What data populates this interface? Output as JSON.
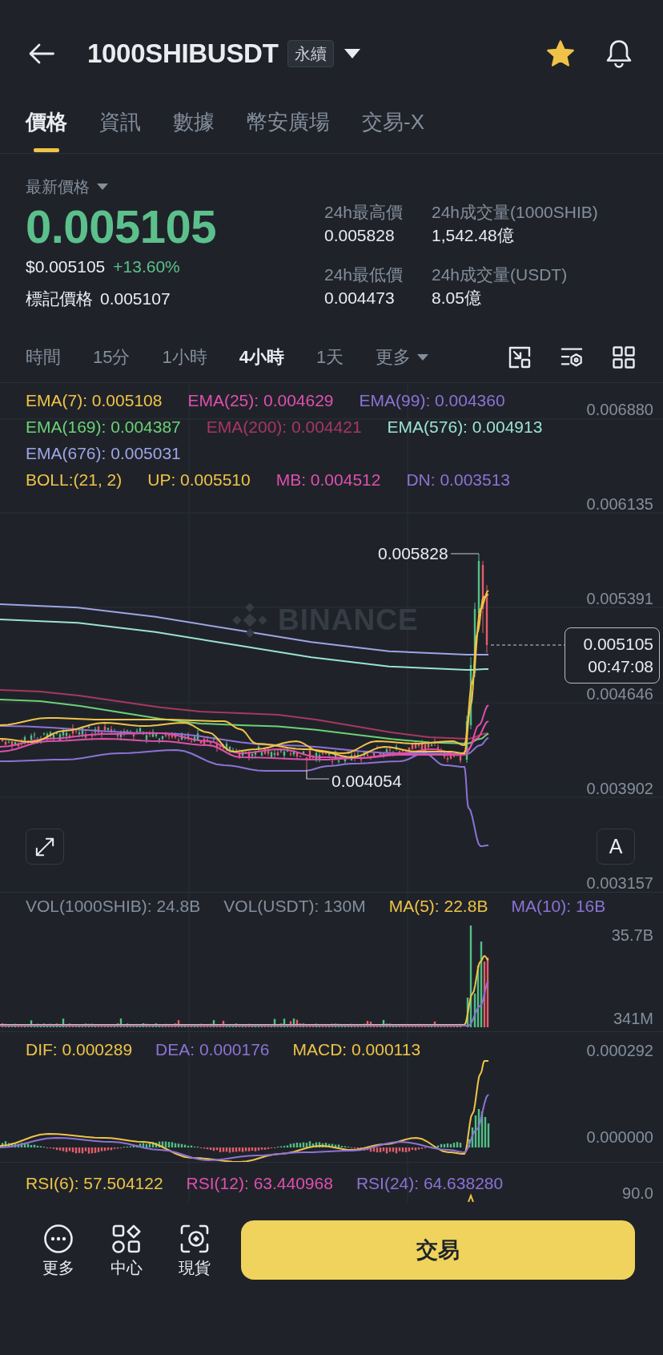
{
  "header": {
    "symbol": "1000SHIBUSDT",
    "contract_badge": "永續",
    "favorited": true
  },
  "tabs": [
    {
      "label": "價格",
      "selected": true
    },
    {
      "label": "資訊",
      "selected": false
    },
    {
      "label": "數據",
      "selected": false
    },
    {
      "label": "幣安廣場",
      "selected": false
    },
    {
      "label": "交易-X",
      "selected": false
    }
  ],
  "price": {
    "label": "最新價格",
    "last": "0.005105",
    "usd": "$0.005105",
    "change": "+13.60%",
    "mark_label": "標記價格",
    "mark_value": "0.005107"
  },
  "stats": [
    {
      "label": "24h最高價",
      "value": "0.005828"
    },
    {
      "label": "24h成交量(1000SHIB)",
      "value": "1,542.48億"
    },
    {
      "label": "24h最低價",
      "value": "0.004473"
    },
    {
      "label": "24h成交量(USDT)",
      "value": "8.05億"
    }
  ],
  "intervals": {
    "label": "時間",
    "options": [
      {
        "label": "15分",
        "selected": false
      },
      {
        "label": "1小時",
        "selected": false
      },
      {
        "label": "4小時",
        "selected": true
      },
      {
        "label": "1天",
        "selected": false
      }
    ],
    "more": "更多"
  },
  "main_chart": {
    "legend_rows": [
      [
        {
          "text": "EMA(7): 0.005108",
          "color": "#f0c348"
        },
        {
          "text": "EMA(25): 0.004629",
          "color": "#e04fae"
        },
        {
          "text": "EMA(99): 0.004360",
          "color": "#8d72d6"
        }
      ],
      [
        {
          "text": "EMA(169): 0.004387",
          "color": "#6bd276"
        },
        {
          "text": "EMA(200): 0.004421",
          "color": "#a8375f"
        },
        {
          "text": "EMA(576): 0.004913",
          "color": "#9be3d0"
        }
      ],
      [
        {
          "text": "EMA(676): 0.005031",
          "color": "#9fa4e6"
        }
      ],
      [
        {
          "text": "BOLL:(21, 2)",
          "color": "#f0c348"
        },
        {
          "text": "UP: 0.005510",
          "color": "#f0c348"
        },
        {
          "text": "MB: 0.004512",
          "color": "#e04fae"
        },
        {
          "text": "DN: 0.003513",
          "color": "#8d72d6"
        }
      ]
    ],
    "price_axis": [
      "0.006880",
      "0.006135",
      "0.005391",
      "0.004646",
      "0.003902",
      "0.003157"
    ],
    "high_label": "0.005828",
    "low_label": "0.004054",
    "last_price": "0.005105",
    "countdown": "00:47:08",
    "watermark": "BINANCE",
    "scale_button": "A"
  },
  "volume_panel": {
    "legend": [
      {
        "text": "VOL(1000SHIB): 24.8B",
        "color": "#848e9c"
      },
      {
        "text": "VOL(USDT): 130M",
        "color": "#848e9c"
      },
      {
        "text": "MA(5): 22.8B",
        "color": "#f0c348"
      },
      {
        "text": "MA(10): 16B",
        "color": "#8d72d6"
      }
    ],
    "axis": [
      "35.7B",
      "341M"
    ]
  },
  "macd_panel": {
    "legend": [
      {
        "text": "DIF: 0.000289",
        "color": "#f0c348"
      },
      {
        "text": "DEA: 0.000176",
        "color": "#8d72d6"
      },
      {
        "text": "MACD: 0.000113",
        "color": "#f0c348"
      }
    ],
    "axis": [
      "0.000292",
      "0.000000"
    ]
  },
  "rsi_panel": {
    "legend": [
      {
        "text": "RSI(6): 57.504122",
        "color": "#f0c348"
      },
      {
        "text": "RSI(12): 63.440968",
        "color": "#e04fae"
      },
      {
        "text": "RSI(24): 64.638280",
        "color": "#8d72d6"
      }
    ],
    "axis": [
      "90.0"
    ]
  },
  "bottom_bar": {
    "items": [
      {
        "label": "更多",
        "kind": "more"
      },
      {
        "label": "中心",
        "kind": "hub"
      },
      {
        "label": "現貨",
        "kind": "spot"
      }
    ],
    "trade_button": "交易"
  }
}
